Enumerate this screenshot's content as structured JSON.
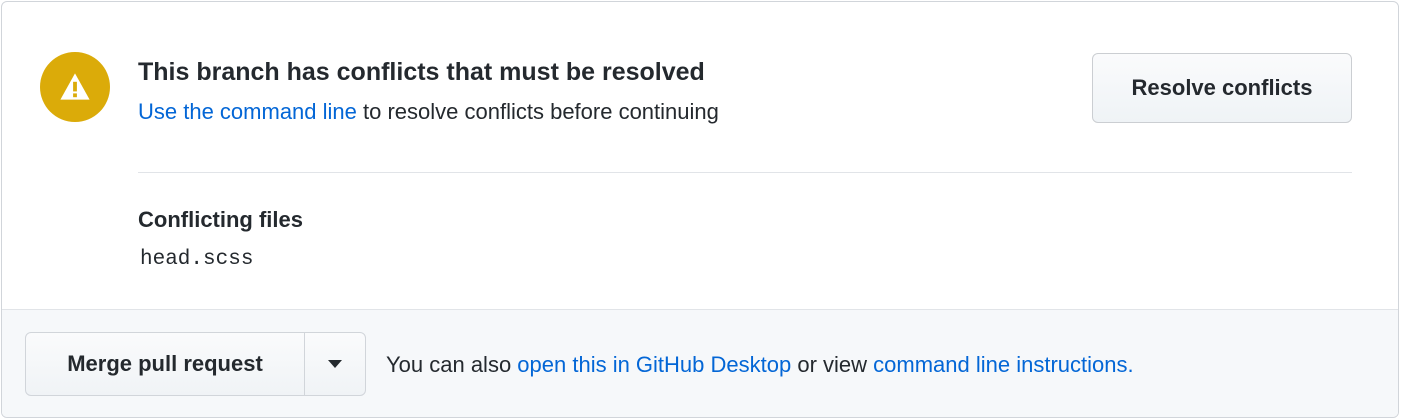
{
  "conflict": {
    "icon": "alert-icon",
    "icon_color": "#dbab09",
    "title": "This branch has conflicts that must be resolved",
    "subtitle_link": "Use the command line",
    "subtitle_rest": " to resolve conflicts before continuing",
    "resolve_button": "Resolve conflicts"
  },
  "files": {
    "heading": "Conflicting files",
    "items": [
      "head.scss"
    ]
  },
  "footer": {
    "merge_button": "Merge pull request",
    "caret_icon": "triangle-down-icon",
    "text_prefix": "You can also ",
    "desktop_link": "open this in GitHub Desktop",
    "text_middle": " or view ",
    "instructions_link": "command line instructions."
  },
  "colors": {
    "link": "#0366d6",
    "text": "#24292e",
    "footer_bg": "#f6f8fa"
  }
}
